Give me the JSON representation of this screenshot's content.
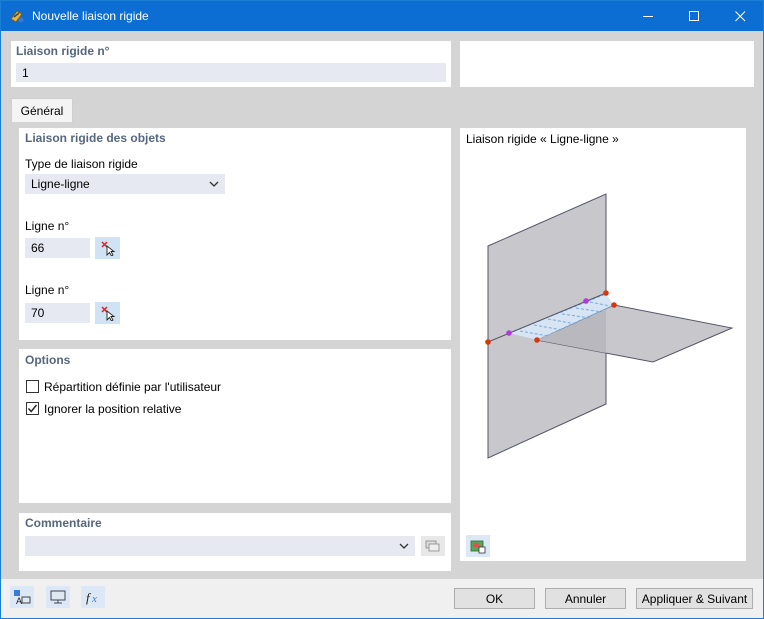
{
  "window": {
    "title": "Nouvelle liaison rigide"
  },
  "header": {
    "number_label": "Liaison rigide n°",
    "number_value": "1"
  },
  "tabs": [
    {
      "label": "Général"
    }
  ],
  "objects_section": {
    "title": "Liaison rigide des objets",
    "type_label": "Type de liaison rigide",
    "type_value": "Ligne-ligne",
    "line1_label": "Ligne n°",
    "line1_value": "66",
    "line2_label": "Ligne n°",
    "line2_value": "70"
  },
  "options_section": {
    "title": "Options",
    "checkbox1_label": "Répartition définie par l'utilisateur",
    "checkbox1_checked": false,
    "checkbox2_label": "Ignorer la position relative",
    "checkbox2_checked": true
  },
  "comment_section": {
    "title": "Commentaire",
    "value": ""
  },
  "preview": {
    "title": "Liaison rigide « Ligne-ligne »"
  },
  "buttons": {
    "ok": "OK",
    "cancel": "Annuler",
    "apply_next": "Appliquer & Suivant"
  },
  "icons": {
    "app": "rigid-link-icon",
    "pick": "pick-object-icon",
    "dropdown": "chevron-down-icon",
    "comment_library": "comment-library-icon",
    "preview_options": "preview-options-icon",
    "tool1": "units-icon",
    "tool2": "view-icon",
    "tool3": "formula-icon"
  },
  "colors": {
    "titlebar": "#0c6dd2",
    "section_title": "#55677f",
    "field": "#e6e9f2",
    "workarea": "#d4d4d4"
  }
}
